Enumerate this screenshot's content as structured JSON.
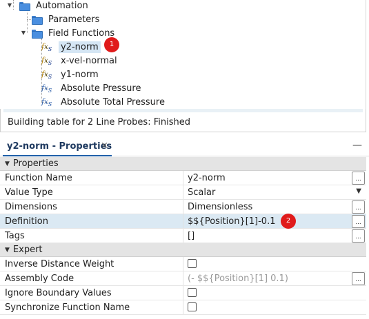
{
  "tree": {
    "items": [
      {
        "label": "Automation",
        "kind": "folder",
        "expanded": true
      },
      {
        "label": "Parameters",
        "kind": "folder"
      },
      {
        "label": "Field Functions",
        "kind": "folder",
        "expanded": true
      },
      {
        "label": "y2-norm",
        "kind": "user-function",
        "selected": true
      },
      {
        "label": "x-vel-normal",
        "kind": "user-function"
      },
      {
        "label": "y1-norm",
        "kind": "user-function"
      },
      {
        "label": "Absolute Pressure",
        "kind": "system-function"
      },
      {
        "label": "Absolute Total Pressure",
        "kind": "system-function"
      }
    ],
    "callout": "1"
  },
  "output": {
    "status": "Building table for 2 Line Probes: Finished"
  },
  "properties_tab": {
    "title": "y2-norm - Properties",
    "close": "×",
    "minimize": "—"
  },
  "grid": {
    "sections": [
      {
        "label": "Properties"
      },
      {
        "label": "Expert"
      }
    ],
    "rows": [
      {
        "name": "Function Name",
        "value": "y2-norm",
        "control": "ellipsis"
      },
      {
        "name": "Value Type",
        "value": "Scalar",
        "control": "dropdown"
      },
      {
        "name": "Dimensions",
        "value": "Dimensionless",
        "control": "ellipsis"
      },
      {
        "name": "Definition",
        "value": "$${Position}[1]-0.1",
        "control": "ellipsis",
        "highlight": true
      },
      {
        "name": "Tags",
        "value": "[]",
        "control": "ellipsis"
      },
      {
        "name": "Inverse Distance Weight",
        "value": "",
        "control": "checkbox",
        "checked": false
      },
      {
        "name": "Assembly Code",
        "value": "(- $${Position}[1] 0.1)",
        "control": "ellipsis",
        "dim": true
      },
      {
        "name": "Ignore Boundary Values",
        "value": "",
        "control": "checkbox",
        "checked": false
      },
      {
        "name": "Synchronize Function Name",
        "value": "",
        "control": "checkbox",
        "checked": false
      }
    ],
    "callout": "2",
    "ellipsis_label": "..."
  },
  "colors": {
    "accent": "#1f5fa8",
    "selection": "#d5e6f4",
    "row_highlight": "#dbe9f3",
    "callout": "#e01b1b"
  }
}
